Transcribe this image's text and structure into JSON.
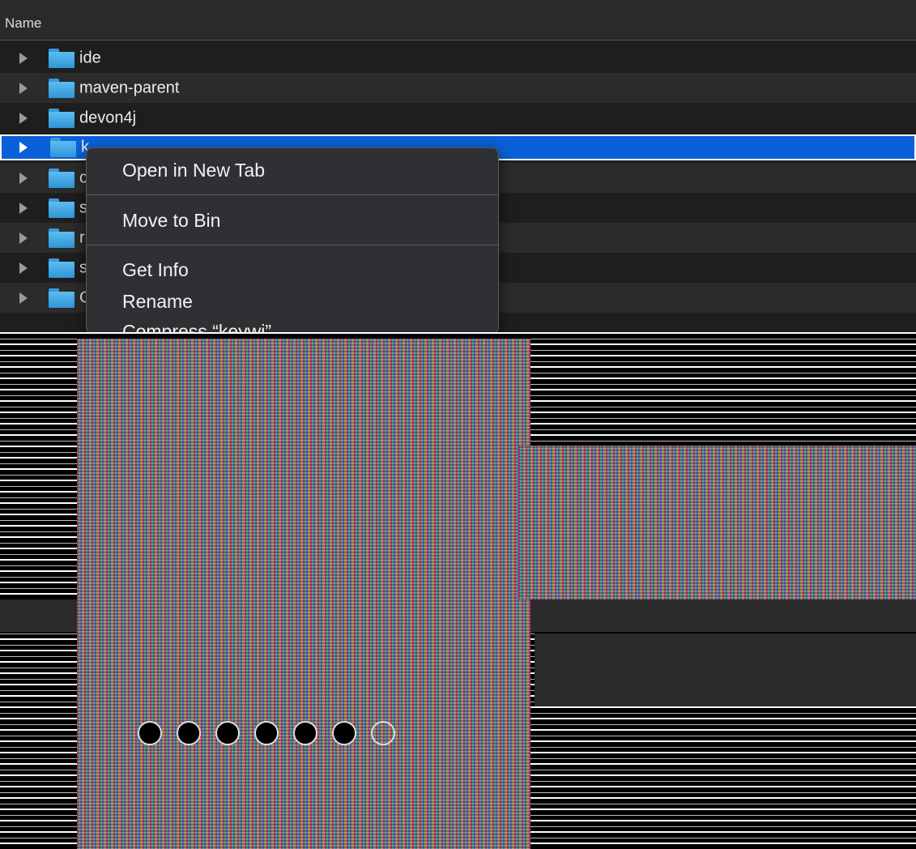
{
  "header": {
    "name_column": "Name"
  },
  "rows": [
    {
      "label": "ide"
    },
    {
      "label": "maven-parent"
    },
    {
      "label": "devon4j"
    },
    {
      "label": "k"
    },
    {
      "label": "c"
    },
    {
      "label": "s"
    },
    {
      "label": "r"
    },
    {
      "label": "s"
    },
    {
      "label": "C"
    }
  ],
  "context_menu": {
    "open_new_tab": "Open in New Tab",
    "move_to_bin": "Move to Bin",
    "get_info": "Get Info",
    "rename": "Rename",
    "compress": "Compress “keywi”"
  },
  "colors": {
    "selection": "#0a60d8",
    "folder": "#4aaeea",
    "menu_bg": "#2f3033"
  }
}
